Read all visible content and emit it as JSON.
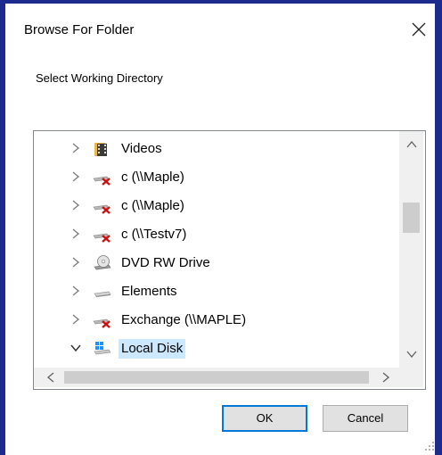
{
  "dialog": {
    "title": "Browse For Folder",
    "close_icon": "close-icon",
    "prompt": "Select Working Directory",
    "ok_label": "OK",
    "cancel_label": "Cancel"
  },
  "tree": {
    "items": [
      {
        "label": "Videos",
        "icon": "videos-folder-icon",
        "expanded": false,
        "selected": false
      },
      {
        "label": "c (\\\\Maple)",
        "icon": "disconnected-network-drive-icon",
        "expanded": false,
        "selected": false
      },
      {
        "label": "c (\\\\Maple)",
        "icon": "disconnected-network-drive-icon",
        "expanded": false,
        "selected": false
      },
      {
        "label": "c (\\\\Testv7)",
        "icon": "disconnected-network-drive-icon",
        "expanded": false,
        "selected": false
      },
      {
        "label": "DVD RW Drive",
        "icon": "dvd-drive-icon",
        "expanded": false,
        "selected": false
      },
      {
        "label": "Elements",
        "icon": "external-drive-icon",
        "expanded": false,
        "selected": false
      },
      {
        "label": "Exchange (\\\\MAPLE)",
        "icon": "disconnected-network-drive-icon",
        "expanded": false,
        "selected": false
      },
      {
        "label": "Local Disk",
        "icon": "local-disk-icon",
        "expanded": true,
        "selected": true
      }
    ]
  },
  "colors": {
    "frame": "#1d2b8e",
    "selection": "#cce8ff",
    "accent": "#0078d7",
    "disconnected": "#d01010"
  }
}
